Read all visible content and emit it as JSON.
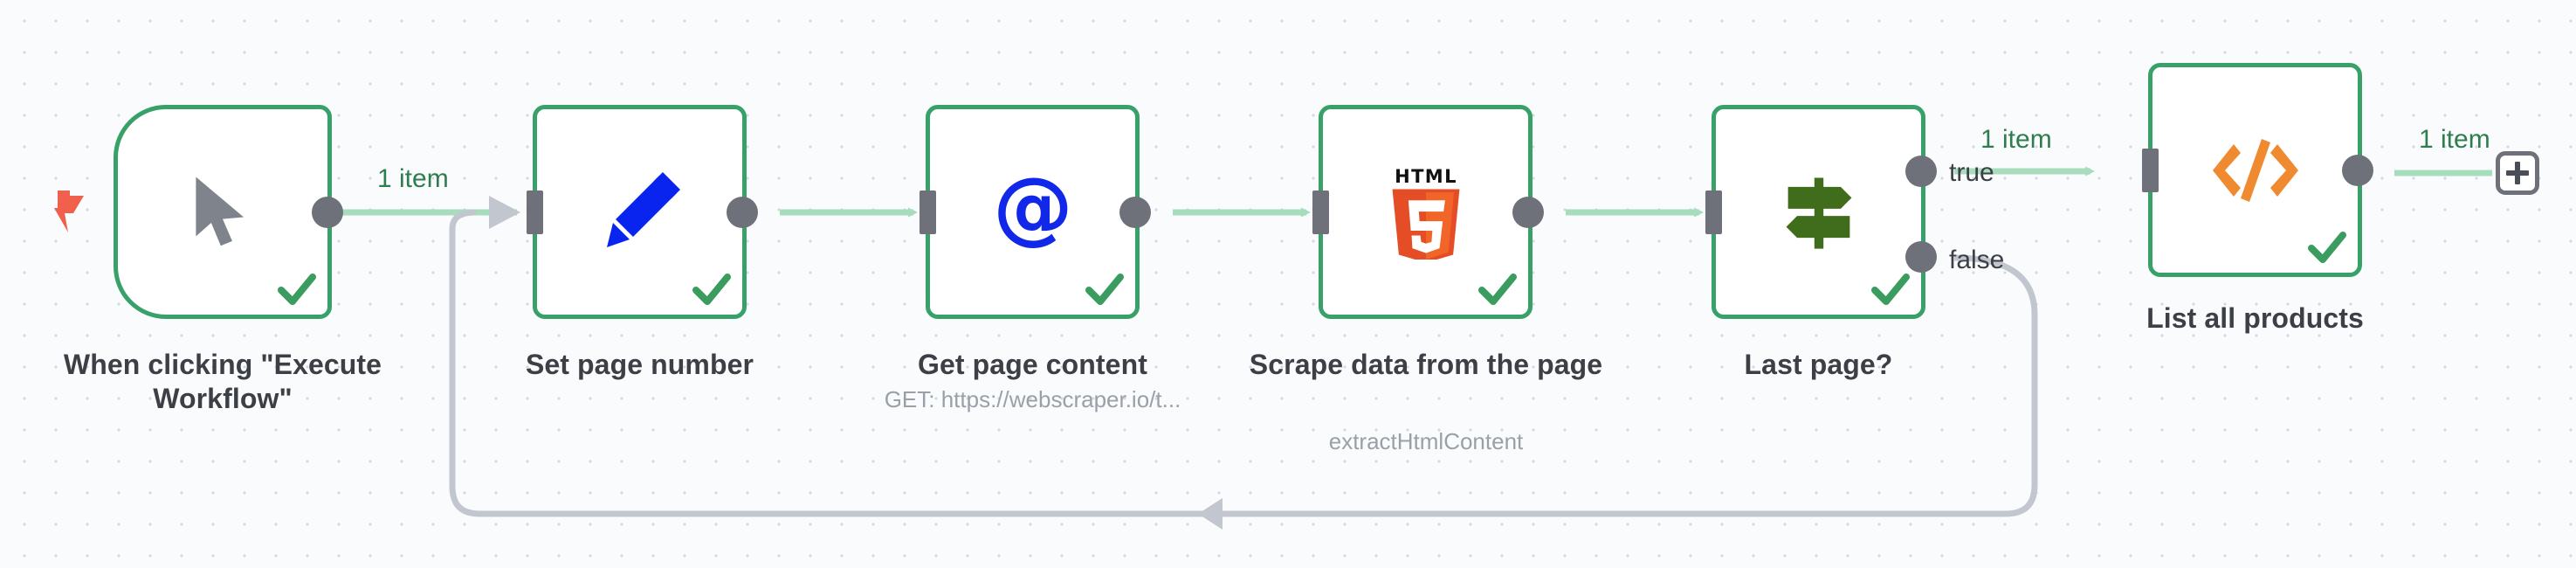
{
  "canvas": {
    "background_color": "#fafbfc",
    "grid_dot_color": "#d3d9e0"
  },
  "theme": {
    "node_border": "#38a169",
    "node_fill": "#ffffff",
    "port": "#6e7179",
    "wire_active": "#a7dcbc",
    "wire_loop": "#c2c6cf",
    "label_text": "#3c3f45",
    "item_label_text": "#2e7d4f",
    "subtitle_text": "#9aa0a8",
    "trigger_bolt": "#f0604d",
    "html5_orange": "#e44d26",
    "html5_orange_light": "#f16529",
    "code_orange": "#f08a31",
    "switch_green": "#3f6d1c",
    "edit_blue": "#0a24ef",
    "http_blue": "#1128e8",
    "cursor_gray": "#7f838b"
  },
  "nodes": [
    {
      "id": "trigger",
      "title": "When clicking \"Execute Workflow\"",
      "subtitle": "",
      "icon": "cursor-pointer-icon",
      "shape": "trigger",
      "status": "success",
      "has_input": false,
      "outputs": [
        ""
      ]
    },
    {
      "id": "set-page-number",
      "title": "Set page number",
      "subtitle": "",
      "icon": "pencil-edit-icon",
      "shape": "rect",
      "status": "success",
      "has_input": true,
      "outputs": [
        ""
      ]
    },
    {
      "id": "get-page-content",
      "title": "Get page content",
      "subtitle": "GET: https://webscraper.io/t...",
      "icon": "at-sign-icon",
      "shape": "rect",
      "status": "success",
      "has_input": true,
      "outputs": [
        ""
      ]
    },
    {
      "id": "scrape-data",
      "title": "Scrape data from the page",
      "subtitle": "extractHtmlContent",
      "icon": "html5-logo-icon",
      "shape": "rect",
      "status": "success",
      "has_input": true,
      "outputs": [
        ""
      ]
    },
    {
      "id": "last-page",
      "title": "Last page?",
      "subtitle": "",
      "icon": "signpost-switch-icon",
      "shape": "rect",
      "status": "success",
      "has_input": true,
      "outputs": [
        "true",
        "false"
      ]
    },
    {
      "id": "list-all-products",
      "title": "List all products",
      "subtitle": "",
      "icon": "code-brackets-icon",
      "shape": "rect",
      "status": "success",
      "has_input": true,
      "outputs": [
        ""
      ]
    }
  ],
  "connections": [
    {
      "id": "c1",
      "from": "trigger",
      "to": "set-page-number",
      "label": "1 item",
      "kind": "active"
    },
    {
      "id": "c2",
      "from": "set-page-number",
      "to": "get-page-content",
      "label": "",
      "kind": "active"
    },
    {
      "id": "c3",
      "from": "get-page-content",
      "to": "scrape-data",
      "label": "",
      "kind": "active"
    },
    {
      "id": "c4",
      "from": "scrape-data",
      "to": "last-page",
      "label": "",
      "kind": "active"
    },
    {
      "id": "c5",
      "from": "last-page",
      "to": "list-all-products",
      "label": "1 item",
      "branch": "true",
      "kind": "active"
    },
    {
      "id": "c6",
      "from": "last-page",
      "to": "set-page-number",
      "label": "",
      "branch": "false",
      "kind": "loop"
    },
    {
      "id": "c7",
      "from": "list-all-products",
      "to": "add-node-button",
      "label": "1 item",
      "kind": "active"
    }
  ],
  "branch_labels": {
    "true": "true",
    "false": "false"
  },
  "add_button": {
    "label": "+",
    "name": "add-node-button"
  },
  "item_labels": {
    "one_item": "1 item"
  }
}
